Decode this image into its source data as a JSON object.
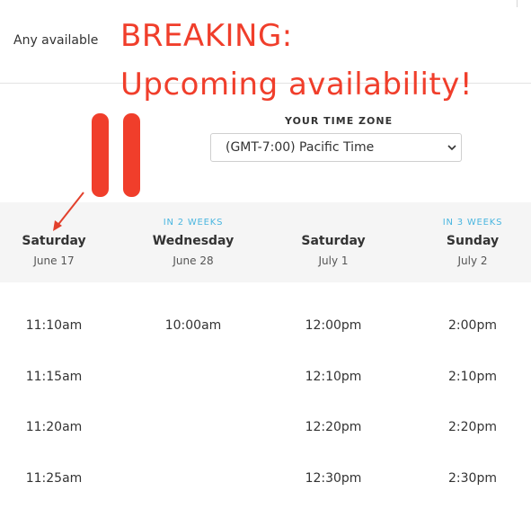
{
  "header": {
    "any_available": "Any available",
    "headline_line1": "BREAKING:",
    "headline_line2": "Upcoming availability!"
  },
  "timezone": {
    "label": "YOUR TIME ZONE",
    "selected": "(GMT-7:00) Pacific Time",
    "icon": "chevron-down-icon"
  },
  "colors": {
    "annotation_red": "#f03e2b",
    "tag_blue": "#4ab6e0",
    "band_gray": "#f5f5f5"
  },
  "days": [
    {
      "tag": "",
      "name": "Saturday",
      "date": "June 17",
      "times": [
        "11:10am",
        "11:15am",
        "11:20am",
        "11:25am"
      ]
    },
    {
      "tag": "IN 2 WEEKS",
      "name": "Wednesday",
      "date": "June 28",
      "times": [
        "10:00am",
        "",
        "",
        ""
      ]
    },
    {
      "tag": "",
      "name": "Saturday",
      "date": "July 1",
      "times": [
        "12:00pm",
        "12:10pm",
        "12:20pm",
        "12:30pm"
      ]
    },
    {
      "tag": "IN 3 WEEKS",
      "name": "Sunday",
      "date": "July 2",
      "times": [
        "2:00pm",
        "2:10pm",
        "2:20pm",
        "2:30pm"
      ]
    }
  ]
}
